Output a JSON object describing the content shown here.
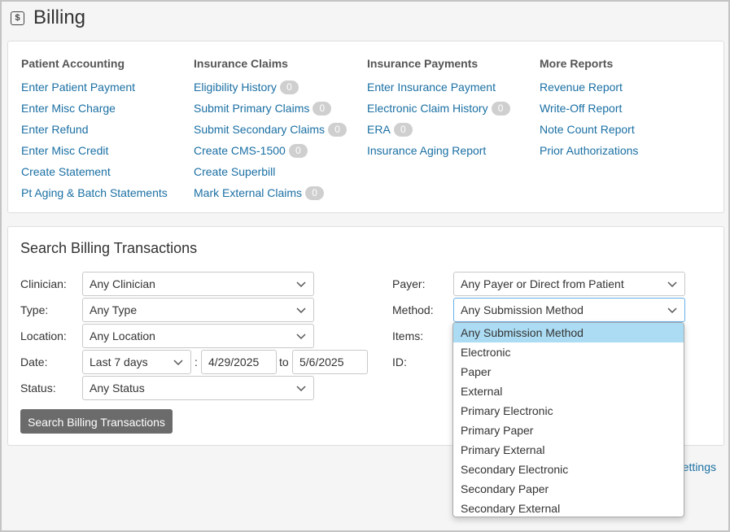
{
  "header": {
    "title": "Billing",
    "icon": "dollar-icon"
  },
  "columns": [
    {
      "heading": "Patient Accounting",
      "links": [
        {
          "label": "Enter Patient Payment"
        },
        {
          "label": "Enter Misc Charge"
        },
        {
          "label": "Enter Refund"
        },
        {
          "label": "Enter Misc Credit"
        },
        {
          "label": "Create Statement"
        },
        {
          "label": "Pt Aging & Batch Statements"
        }
      ]
    },
    {
      "heading": "Insurance Claims",
      "links": [
        {
          "label": "Eligibility History",
          "badge": "0"
        },
        {
          "label": "Submit Primary Claims",
          "badge": "0"
        },
        {
          "label": "Submit Secondary Claims",
          "badge": "0"
        },
        {
          "label": "Create CMS-1500",
          "badge": "0"
        },
        {
          "label": "Create Superbill"
        },
        {
          "label": "Mark External Claims",
          "badge": "0"
        }
      ]
    },
    {
      "heading": "Insurance Payments",
      "links": [
        {
          "label": "Enter Insurance Payment"
        },
        {
          "label": "Electronic Claim History",
          "badge": "0"
        },
        {
          "label": "ERA",
          "badge": "0"
        },
        {
          "label": "Insurance Aging Report"
        }
      ]
    },
    {
      "heading": "More Reports",
      "links": [
        {
          "label": "Revenue Report"
        },
        {
          "label": "Write-Off Report"
        },
        {
          "label": "Note Count Report"
        },
        {
          "label": "Prior Authorizations"
        }
      ]
    }
  ],
  "search": {
    "title": "Search Billing Transactions",
    "clinician": {
      "label": "Clinician:",
      "value": "Any Clinician"
    },
    "type": {
      "label": "Type:",
      "value": "Any Type"
    },
    "location": {
      "label": "Location:",
      "value": "Any Location"
    },
    "date": {
      "label": "Date:",
      "range": "Last 7 days",
      "colon": ":",
      "from": "4/29/2025",
      "to_label": "to",
      "to": "5/6/2025"
    },
    "status": {
      "label": "Status:",
      "value": "Any Status"
    },
    "payer": {
      "label": "Payer:",
      "value": "Any Payer or Direct from Patient"
    },
    "method": {
      "label": "Method:",
      "value": "Any Submission Method"
    },
    "items": {
      "label": "Items:"
    },
    "id": {
      "label": "ID:"
    },
    "button": "Search Billing Transactions"
  },
  "settings_link": "ettings",
  "method_dropdown": {
    "selected_index": 0,
    "options": [
      "Any Submission Method",
      "Electronic",
      "Paper",
      "External",
      "Primary Electronic",
      "Primary Paper",
      "Primary External",
      "Secondary Electronic",
      "Secondary Paper",
      "Secondary External"
    ]
  },
  "colors": {
    "link": "#1a6fa3",
    "badge": "#cfcfcf",
    "button": "#6b6b6b",
    "highlight": "#acdcf3"
  }
}
